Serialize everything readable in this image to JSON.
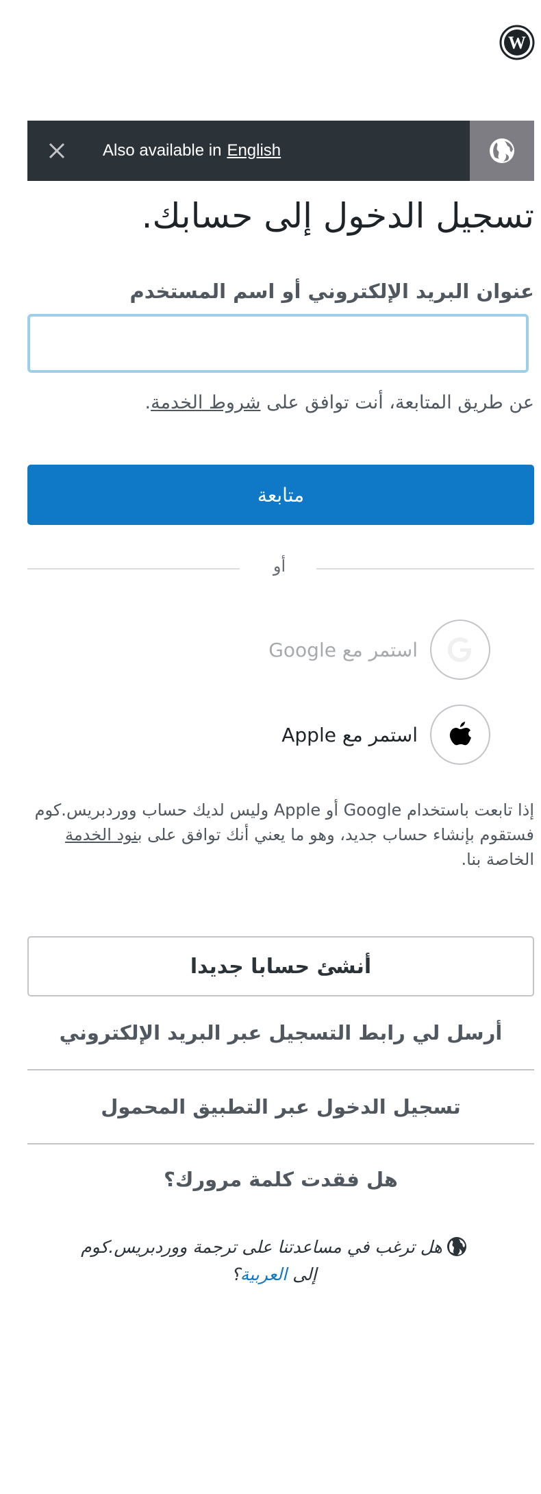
{
  "banner": {
    "text": "Also available in",
    "link": "English"
  },
  "page": {
    "title": "تسجيل الدخول إلى حسابك."
  },
  "form": {
    "email_label": "عنوان البريد الإلكتروني أو اسم المستخدم",
    "email_value": "",
    "terms_prefix": "عن طريق المتابعة، أنت توافق على ",
    "terms_link": "شروط الخدمة",
    "terms_suffix": ".",
    "continue_label": "متابعة"
  },
  "divider": {
    "or_label": "أو"
  },
  "social": {
    "google_label": "استمر مع Google",
    "apple_label": "استمر مع Apple",
    "note_text": "إذا تابعت باستخدام Google أو Apple وليس لديك حساب ووردبريس.كوم فستقوم بإنشاء حساب جديد، وهو ما يعني أنك توافق على ",
    "note_link": "بنود الخدمة",
    "note_suffix": " الخاصة بنا."
  },
  "links": {
    "create_account": "أنشئ حسابا جديدا",
    "email_link": "أرسل لي رابط التسجيل عبر البريد الإلكتروني",
    "mobile_app": "تسجيل الدخول عبر التطبيق المحمول",
    "lost_password": "هل فقدت كلمة مرورك؟"
  },
  "translate": {
    "text": "هل ترغب في مساعدتنا على ترجمة ووردبريس.كوم إلى ",
    "link": "العربية",
    "suffix": "؟"
  },
  "icons": [
    "wordpress-logo-icon",
    "close-icon",
    "globe-icon",
    "google-icon",
    "apple-icon"
  ],
  "colors": {
    "primary": "#0f78c7",
    "banner": "#2c3338",
    "globe_box": "#7e7d83"
  }
}
